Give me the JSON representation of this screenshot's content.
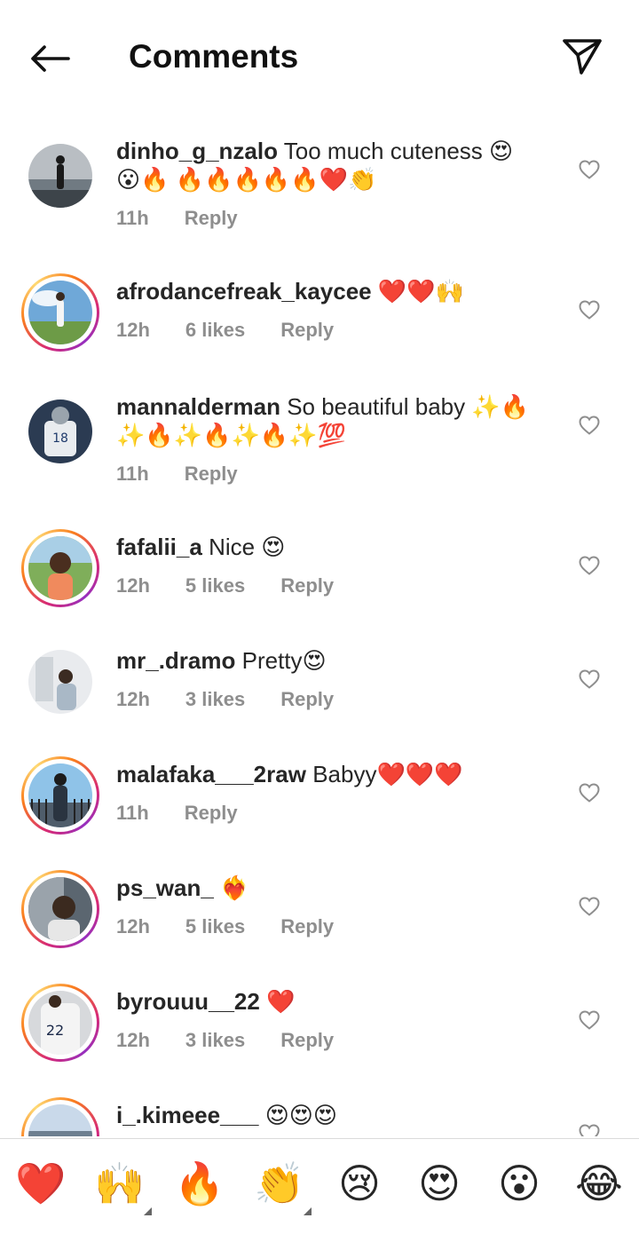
{
  "header": {
    "title": "Comments",
    "back_icon": "arrow-left-icon",
    "send_icon": "paper-plane-icon"
  },
  "comments": [
    {
      "username": "dinho_g_nzalo",
      "text": "Too much cuteness 😍",
      "text_line2": "😮🔥 🔥🔥🔥🔥🔥❤️👏",
      "time": "11h",
      "likes": "",
      "reply": "Reply",
      "ring": false
    },
    {
      "username": "afrodancefreak_kaycee",
      "text": "❤️❤️🙌",
      "time": "12h",
      "likes": "6 likes",
      "reply": "Reply",
      "ring": true
    },
    {
      "username": "mannalderman",
      "text": "So beautiful baby ✨🔥",
      "text_line2": "✨🔥✨🔥✨🔥✨💯",
      "time": "11h",
      "likes": "",
      "reply": "Reply",
      "ring": false
    },
    {
      "username": "fafalii_a",
      "text": "Nice 😍",
      "time": "12h",
      "likes": "5 likes",
      "reply": "Reply",
      "ring": true
    },
    {
      "username": "mr_.dramo",
      "text": "Pretty😍",
      "time": "12h",
      "likes": "3 likes",
      "reply": "Reply",
      "ring": false
    },
    {
      "username": "malafaka___2raw",
      "text": "Babyy❤️❤️❤️",
      "time": "11h",
      "likes": "",
      "reply": "Reply",
      "ring": true
    },
    {
      "username": "ps_wan_",
      "text": "❤️‍🔥",
      "time": "12h",
      "likes": "5 likes",
      "reply": "Reply",
      "ring": true
    },
    {
      "username": "byrouuu__22",
      "text": "❤️",
      "time": "12h",
      "likes": "3 likes",
      "reply": "Reply",
      "ring": true
    },
    {
      "username": "i_.kimeee___",
      "text": "😍😍😍",
      "time": "",
      "likes": "",
      "reply": "",
      "ring": true
    }
  ],
  "quick_reactions": [
    "❤️",
    "🙌",
    "🔥",
    "👏",
    "😢",
    "😍",
    "😮",
    "😂"
  ],
  "colors": {
    "text": "#262626",
    "meta": "#8e8e8e",
    "divider": "#dbdbdb",
    "ring_start": "#d62976",
    "ring_end": "#fa7e1e"
  }
}
